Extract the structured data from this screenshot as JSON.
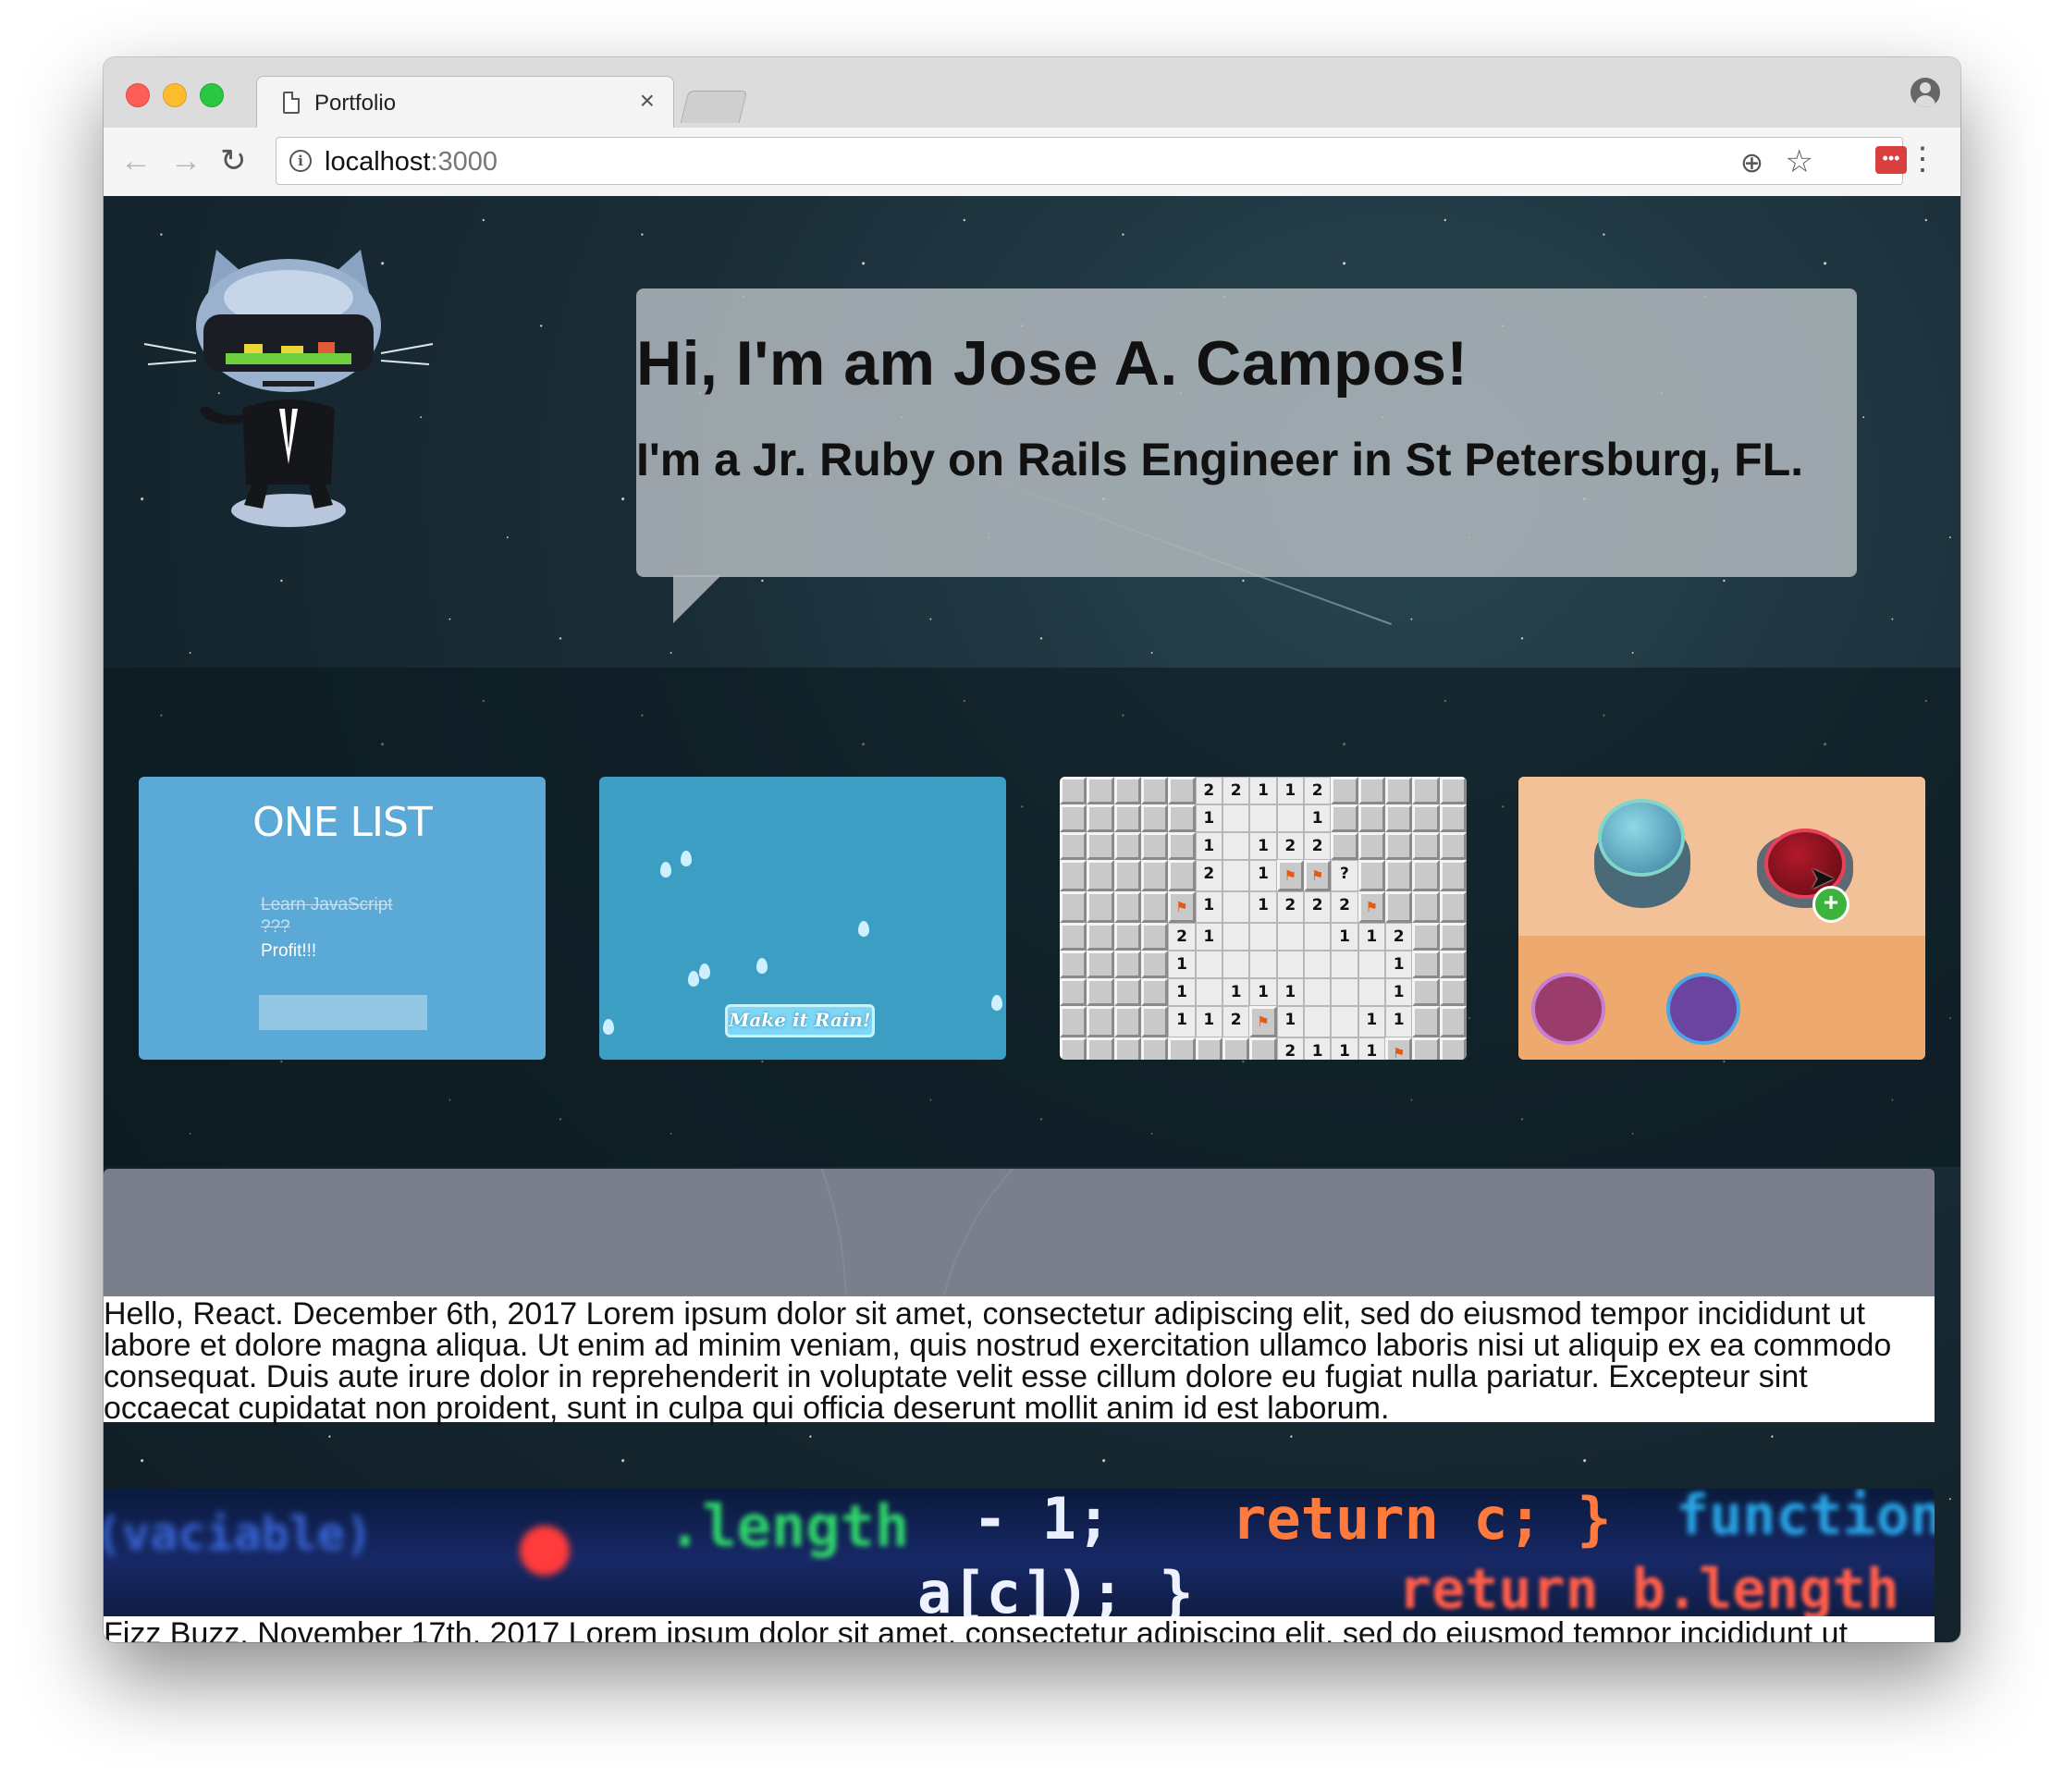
{
  "browser": {
    "tab_title": "Portfolio",
    "tab_close": "×",
    "url_host": "localhost",
    "url_port": ":3000",
    "info_symbol": "i",
    "extension_label": "•••"
  },
  "hero": {
    "title": "Hi, I'm am Jose A. Campos!",
    "subtitle": "I'm a Jr. Ruby on Rails Engineer in St Petersburg, FL."
  },
  "projects": {
    "one_list": {
      "title": "ONE LIST",
      "items": [
        "Learn JavaScript",
        "???",
        "Profit!!!"
      ]
    },
    "make_it_rain": {
      "button_label": "Make it Rain!"
    },
    "minesweeper": {
      "rows": [
        [
          "",
          "",
          "",
          "",
          "",
          "2",
          "2",
          "1",
          "1",
          "2",
          "",
          "",
          "",
          "",
          ""
        ],
        [
          "",
          "",
          "",
          "",
          "",
          "1",
          "",
          "",
          "",
          "1",
          "",
          "",
          "",
          "",
          ""
        ],
        [
          "",
          "",
          "",
          "",
          "",
          "1",
          "",
          "1",
          "2",
          "2",
          "",
          "",
          "",
          "",
          ""
        ],
        [
          "",
          "",
          "",
          "",
          "",
          "2",
          "",
          "1",
          "F",
          "F",
          "?",
          "",
          "",
          "",
          ""
        ],
        [
          "",
          "",
          "",
          "",
          "F",
          "1",
          "",
          "1",
          "2",
          "2",
          "2",
          "F",
          "",
          "",
          ""
        ],
        [
          "",
          "",
          "",
          "",
          "2",
          "1",
          "",
          "",
          "",
          "",
          "1",
          "1",
          "2",
          "",
          ""
        ],
        [
          "",
          "",
          "",
          "",
          "1",
          "",
          "",
          "",
          "",
          "",
          "",
          "",
          "1",
          "",
          ""
        ],
        [
          "",
          "",
          "",
          "",
          "1",
          "",
          "1",
          "1",
          "1",
          "",
          "",
          "",
          "1",
          "",
          ""
        ],
        [
          "",
          "",
          "",
          "",
          "1",
          "1",
          "2",
          "F",
          "1",
          "",
          "",
          "1",
          "1",
          "",
          ""
        ],
        [
          "",
          "",
          "",
          "",
          "",
          "",
          "",
          "",
          "2",
          "1",
          "1",
          "1",
          "F",
          "",
          ""
        ]
      ]
    },
    "creatures": {
      "plus_symbol": "+"
    }
  },
  "posts": [
    {
      "text": "Hello, React. December 6th, 2017 Lorem ipsum dolor sit amet, consectetur adipiscing elit, sed do eiusmod tempor incididunt ut labore et dolore magna aliqua. Ut enim ad minim veniam, quis nostrud exercitation ullamco laboris nisi ut aliquip ex ea commodo consequat. Duis aute irure dolor in reprehenderit in voluptate velit esse cillum dolore eu fugiat nulla pariatur. Excepteur sint occaecat cupidatat non proident, sunt in culpa qui officia deserunt mollit anim id est laborum."
    },
    {
      "text": "Fizz Buzz. November 17th, 2017 Lorem ipsum dolor sit amet, consectetur adipiscing elit, sed do eiusmod tempor incididunt ut",
      "banner_code": {
        "l1": "(vaciable)",
        "l2": ".length",
        "l3": "- 1;",
        "l4": "return c; }",
        "l5": "function",
        "l6": "a[c]);  }",
        "l7": "return b.length"
      }
    }
  ],
  "colors": {
    "page_bg": "#1a2d37",
    "bubble": "#b2babe",
    "one_list_card": "#5aa9d6",
    "rain_card": "#3d9ec4"
  }
}
